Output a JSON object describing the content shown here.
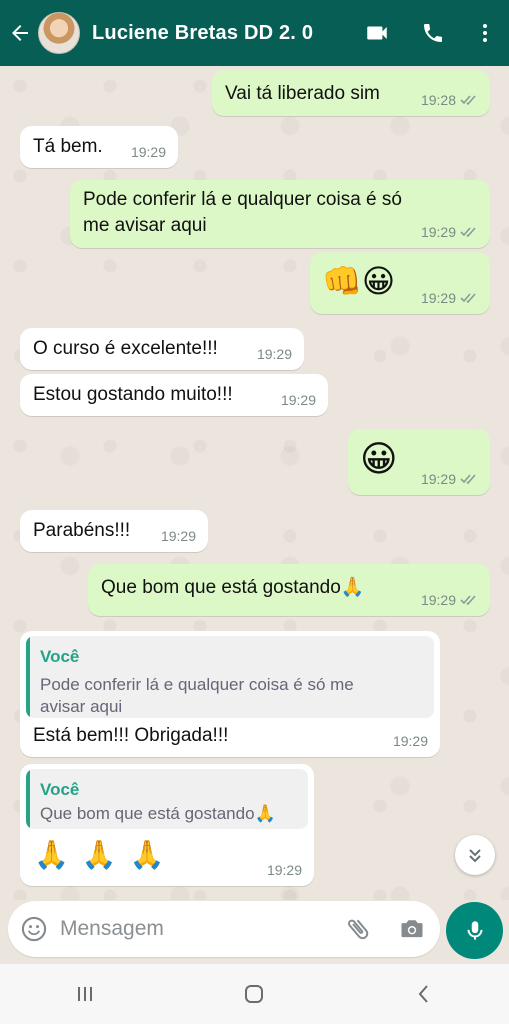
{
  "header": {
    "contact_name": "Luciene Bretas DD 2. 0",
    "icons": [
      "back-arrow-icon",
      "video-call-icon",
      "phone-icon",
      "more-vert-icon"
    ],
    "color": "#075e54"
  },
  "messages": [
    {
      "dir": "out",
      "text": "Vai tá liberado sim",
      "time": "19:28",
      "status": "read"
    },
    {
      "dir": "in",
      "text": "Tá bem.",
      "time": "19:29"
    },
    {
      "dir": "out",
      "text_line1": "Pode conferir lá e qualquer coisa é só",
      "text_line2": "me avisar aqui",
      "time": "19:29",
      "status": "read"
    },
    {
      "dir": "out",
      "emoji": "👊😀",
      "time": "19:29",
      "status": "read"
    },
    {
      "dir": "in",
      "text": "O curso é excelente!!!",
      "time": "19:29"
    },
    {
      "dir": "in",
      "text": "Estou gostando muito!!!",
      "time": "19:29"
    },
    {
      "dir": "out",
      "emoji": "😀",
      "time": "19:29",
      "status": "read"
    },
    {
      "dir": "in",
      "text": "Parabéns!!!",
      "time": "19:29"
    },
    {
      "dir": "out",
      "text": "Que bom que está gostando🙏",
      "time": "19:29",
      "status": "read"
    },
    {
      "dir": "in",
      "quote_author": "Você",
      "quote_line1": "Pode conferir lá e qualquer coisa é só me",
      "quote_line2": "avisar aqui",
      "text": "Está bem!!! Obrigada!!!",
      "time": "19:29"
    },
    {
      "dir": "in",
      "quote_author": "Você",
      "quote_text": "Que bom que está gostando🙏",
      "emoji": "🙏 🙏 🙏",
      "time": "19:29"
    }
  ],
  "input": {
    "placeholder": "Mensagem",
    "icons": [
      "emoji-icon",
      "attach-icon",
      "camera-icon",
      "mic-icon"
    ]
  },
  "colors": {
    "outgoing_bubble": "#dcf8c6",
    "incoming_bubble": "#ffffff",
    "accent": "#00897b",
    "quote_author": "#25a386"
  }
}
